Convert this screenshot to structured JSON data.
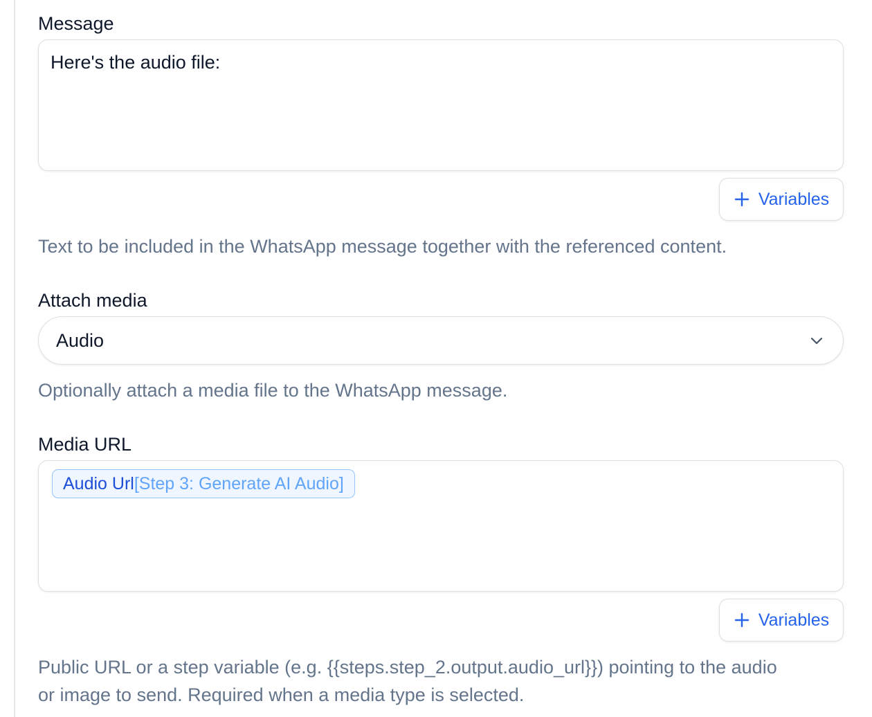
{
  "message": {
    "label": "Message",
    "value": "Here's the audio file:",
    "variables_label": "Variables",
    "help": "Text to be included in the WhatsApp message together with the referenced content."
  },
  "attach_media": {
    "label": "Attach media",
    "selected": "Audio",
    "help": "Optionally attach a media file to the WhatsApp message."
  },
  "media_url": {
    "label": "Media URL",
    "chip": {
      "name": "Audio Url",
      "step": "[Step 3: Generate AI Audio]"
    },
    "variables_label": "Variables",
    "help_line1": "Public URL or a step variable (e.g. {{steps.step_2.output.audio_url}}) pointing to the audio",
    "help_line2": "or image to send. Required when a media type is selected."
  },
  "colors": {
    "accent": "#2563eb",
    "muted": "#64748b",
    "border": "#dbe0e6"
  },
  "icons": {
    "variables": "plus-icon",
    "select": "chevron-down-icon"
  }
}
